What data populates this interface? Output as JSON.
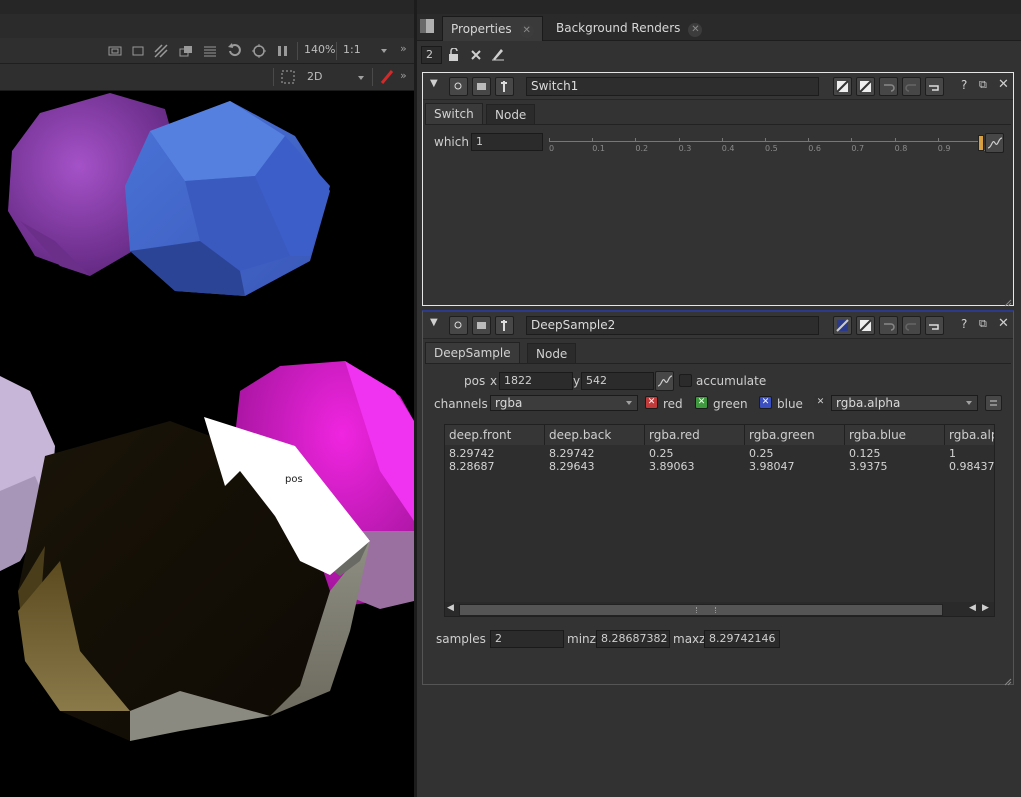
{
  "viewer": {
    "zoom": "140%",
    "proxy": "1:1",
    "view_mode": "2D",
    "overlay_label": "pos"
  },
  "properties": {
    "tabs": [
      {
        "label": "Properties",
        "active": true
      },
      {
        "label": "Background Renders",
        "active": false
      }
    ],
    "max_panels": "2",
    "switch_node": {
      "name": "Switch1",
      "tabs": [
        "Switch",
        "Node"
      ],
      "which_label": "which",
      "which_value": "1",
      "slider_ticks": [
        "0",
        "0.1",
        "0.2",
        "0.3",
        "0.4",
        "0.5",
        "0.6",
        "0.7",
        "0.8",
        "0.9",
        "1"
      ],
      "slider_value": 1
    },
    "deep_sample": {
      "name": "DeepSample2",
      "tabs": [
        "DeepSample",
        "Node"
      ],
      "pos_label": "pos",
      "x_label": "x",
      "x_value": "1822",
      "y_label": "y",
      "y_value": "542",
      "accumulate_label": "accumulate",
      "channels_label": "channels",
      "channels_value": "rgba",
      "red_label": "red",
      "green_label": "green",
      "blue_label": "blue",
      "alpha_value": "rgba.alpha",
      "table": {
        "columns": [
          "deep.front",
          "deep.back",
          "rgba.red",
          "rgba.green",
          "rgba.blue",
          "rgba.alp"
        ],
        "rows": [
          [
            "8.29742",
            "8.29742",
            "0.25",
            "0.25",
            "0.125",
            "1"
          ],
          [
            "8.28687",
            "8.29643",
            "3.89063",
            "3.98047",
            "3.9375",
            "0.98437"
          ]
        ]
      },
      "samples_label": "samples",
      "samples_value": "2",
      "minz_label": "minz",
      "minz_value": "8.28687382",
      "maxz_label": "maxz",
      "maxz_value": "8.29742146"
    }
  },
  "colors": {
    "red_check": "#c23b3b",
    "green_check": "#3f9a3f",
    "blue_check": "#3b4fc0",
    "accent_bar": "#2c3a8c"
  }
}
